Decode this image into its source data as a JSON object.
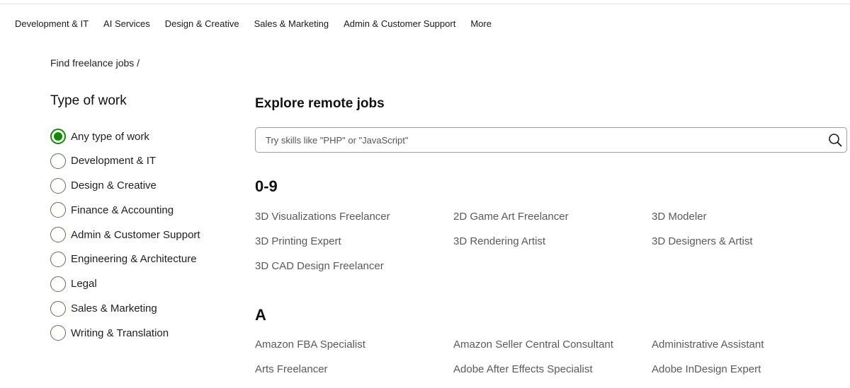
{
  "nav": {
    "items": [
      "Development & IT",
      "AI Services",
      "Design & Creative",
      "Sales & Marketing",
      "Admin & Customer Support",
      "More"
    ]
  },
  "breadcrumb": "Find freelance jobs /",
  "sidebar": {
    "title": "Type of work",
    "options": [
      {
        "label": "Any type of work",
        "checked": true
      },
      {
        "label": "Development & IT",
        "checked": false
      },
      {
        "label": "Design & Creative",
        "checked": false
      },
      {
        "label": "Finance & Accounting",
        "checked": false
      },
      {
        "label": "Admin & Customer Support",
        "checked": false
      },
      {
        "label": "Engineering & Architecture",
        "checked": false
      },
      {
        "label": "Legal",
        "checked": false
      },
      {
        "label": "Sales & Marketing",
        "checked": false
      },
      {
        "label": "Writing & Translation",
        "checked": false
      }
    ]
  },
  "main": {
    "title": "Explore remote jobs",
    "search": {
      "placeholder": "Try skills like \"PHP\" or \"JavaScript\"",
      "value": ""
    },
    "sections": [
      {
        "letter": "0-9",
        "rows": [
          [
            "3D Visualizations Freelancer",
            "2D Game Art Freelancer",
            "3D Modeler"
          ],
          [
            "3D Printing Expert",
            "3D Rendering Artist",
            "3D Designers & Artist"
          ],
          [
            "3D CAD Design Freelancer"
          ]
        ]
      },
      {
        "letter": "A",
        "rows": [
          [
            "Amazon FBA Specialist",
            "Amazon Seller Central Consultant",
            "Administrative Assistant"
          ],
          [
            "Arts Freelancer",
            "Adobe After Effects Specialist",
            "Adobe InDesign Expert"
          ]
        ]
      }
    ]
  },
  "colors": {
    "accent": "#108a00",
    "link_text": "#5a5a5a",
    "border": "#9aa39a"
  }
}
